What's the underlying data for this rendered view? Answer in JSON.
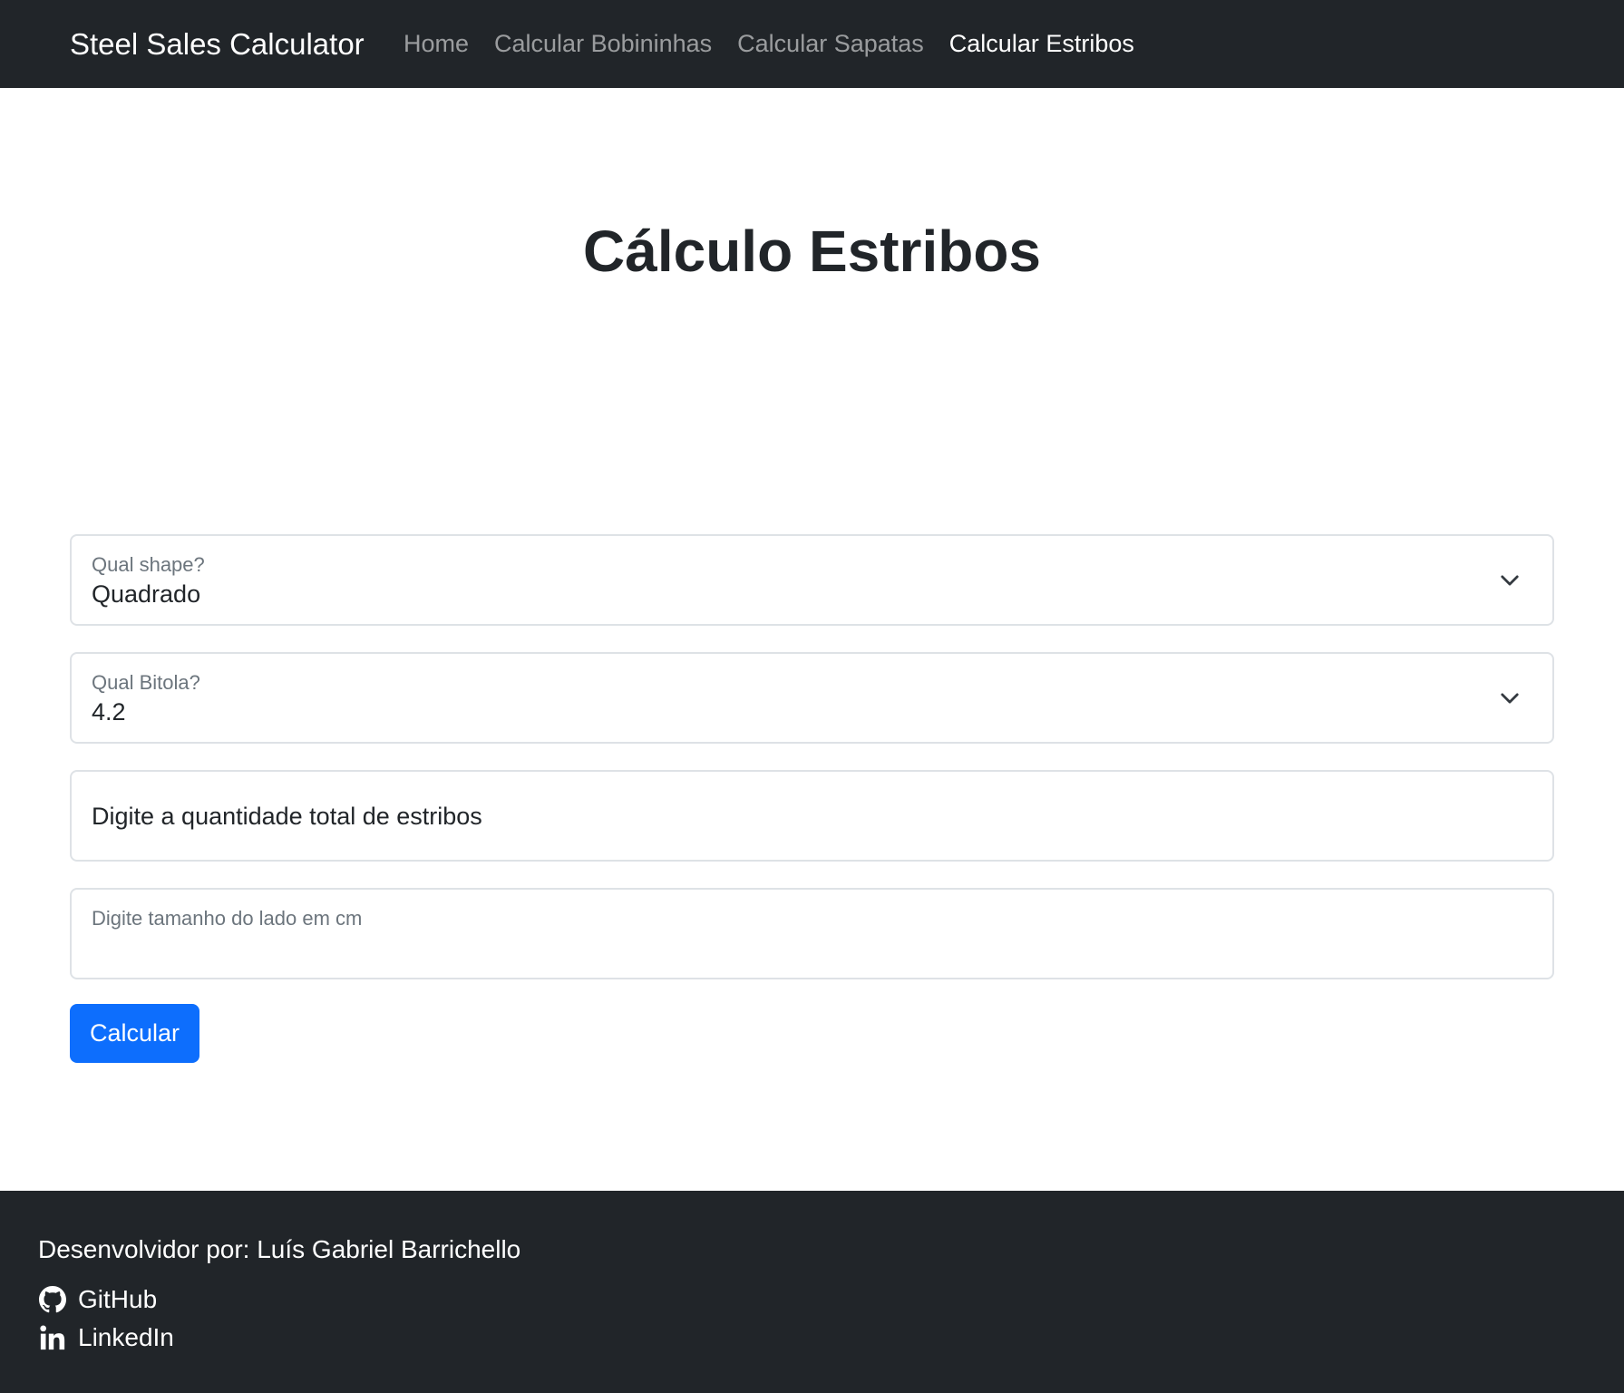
{
  "navbar": {
    "brand": "Steel Sales Calculator",
    "links": [
      {
        "label": "Home",
        "active": false
      },
      {
        "label": "Calcular Bobininhas",
        "active": false
      },
      {
        "label": "Calcular Sapatas",
        "active": false
      },
      {
        "label": "Calcular Estribos",
        "active": true
      }
    ]
  },
  "main": {
    "title": "Cálculo Estribos",
    "shape_select": {
      "label": "Qual shape?",
      "value": "Quadrado",
      "icon": "chevron-down-icon"
    },
    "bitola_select": {
      "label": "Qual Bitola?",
      "value": "4.2",
      "icon": "chevron-down-icon"
    },
    "quantity_input": {
      "placeholder": "Digite a quantidade total de estribos",
      "value": ""
    },
    "side_input": {
      "label": "Digite tamanho do lado em cm",
      "value": ""
    },
    "submit_label": "Calcular"
  },
  "footer": {
    "credit": "Desenvolvidor por: Luís Gabriel Barrichello",
    "links": [
      {
        "label": "GitHub",
        "icon": "github-icon"
      },
      {
        "label": "LinkedIn",
        "icon": "linkedin-icon"
      }
    ]
  },
  "colors": {
    "dark": "#212529",
    "primary": "#0d6efd",
    "border": "#dee2e6",
    "muted": "#6c757d"
  }
}
